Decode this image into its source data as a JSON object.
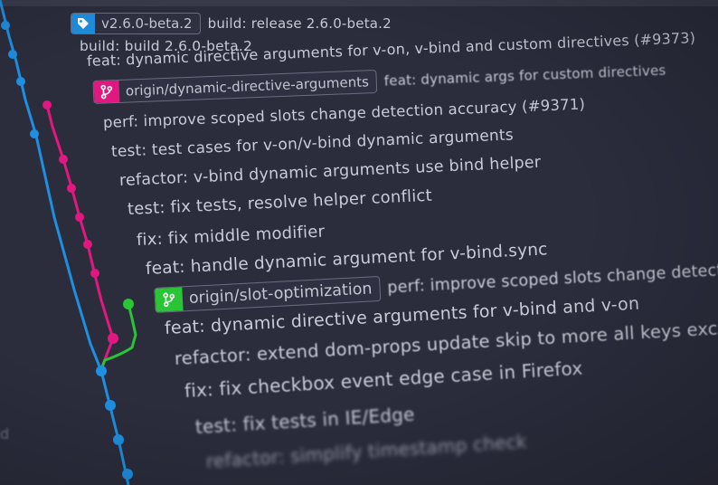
{
  "tags": {
    "version": "v2.6.0-beta.2",
    "dynamic_branch": "origin/dynamic-directive-arguments",
    "slot_branch": "origin/slot-optimization"
  },
  "commits": [
    "build: release 2.6.0-beta.2",
    "build: build 2.6.0-beta.2",
    "feat: dynamic directive arguments for v-on, v-bind and custom directives (#9373)",
    "feat: dynamic args for custom directives",
    "perf: improve scoped slots change detection accuracy (#9371)",
    "test: test cases for v-on/v-bind dynamic arguments",
    "refactor: v-bind dynamic arguments use bind helper",
    "test: fix tests, resolve helper conflict",
    "fix: fix middle modifier",
    "feat: handle dynamic argument for v-bind.sync",
    "perf: improve scoped slots change detection accuracy",
    "feat: dynamic directive arguments for v-bind and v-on",
    "refactor: extend dom-props update skip to more all keys except value",
    "fix: fix checkbox event edge case in Firefox",
    "test: fix tests in IE/Edge",
    "refactor: simplify timestamp check"
  ],
  "left_edge_text": "d",
  "colors": {
    "background": "#2b2d3d",
    "blue": "#1f8fe0",
    "pink": "#e0187f",
    "green": "#29c534"
  },
  "icons": {
    "tag": "tag-icon",
    "branch": "git-branch-icon"
  }
}
